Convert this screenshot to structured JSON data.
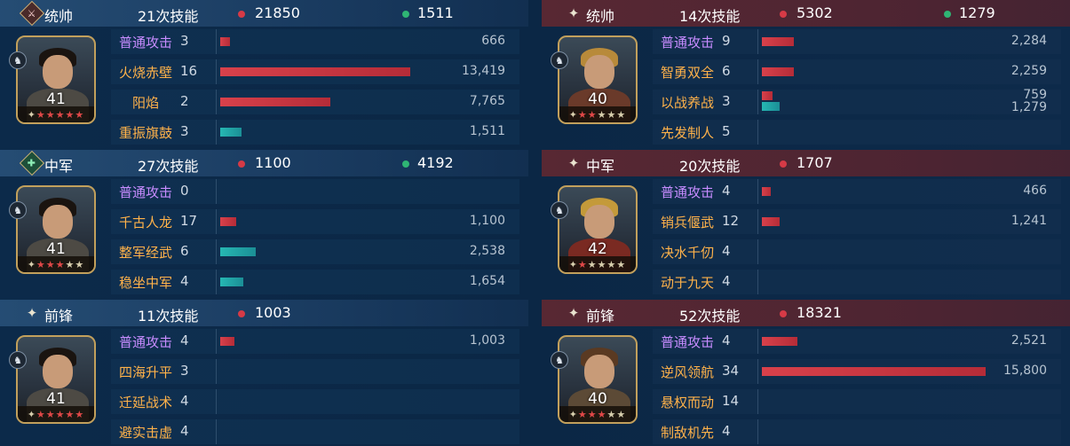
{
  "left": {
    "general": {
      "role": "统帅",
      "casts": "21次技能",
      "dmg": "21850",
      "heal": "1511",
      "level": "41",
      "stars_red": 5,
      "stars_gray": 0
    },
    "mid": {
      "role": "中军",
      "casts": "27次技能",
      "dmg": "1100",
      "heal": "4192",
      "level": "41",
      "stars_red": 3,
      "stars_gray": 2
    },
    "front": {
      "role": "前锋",
      "casts": "11次技能",
      "dmg": "1003",
      "heal": "",
      "level": "41",
      "stars_red": 5,
      "stars_gray": 0
    }
  },
  "right": {
    "general": {
      "role": "统帅",
      "casts": "14次技能",
      "dmg": "5302",
      "heal": "1279",
      "level": "40",
      "stars_red": 2,
      "stars_gray": 3
    },
    "mid": {
      "role": "中军",
      "casts": "20次技能",
      "dmg": "1707",
      "heal": "",
      "level": "42",
      "stars_red": 1,
      "stars_gray": 4
    },
    "front": {
      "role": "前锋",
      "casts": "52次技能",
      "dmg": "18321",
      "heal": "",
      "level": "40",
      "stars_red": 3,
      "stars_gray": 2
    }
  },
  "skills": {
    "l0": [
      {
        "name": "普通攻击",
        "count": "3",
        "basic": true,
        "dmg": 666,
        "dmg_label": "666"
      },
      {
        "name": "火烧赤壁",
        "count": "16",
        "dmg": 13419,
        "dmg_label": "13,419"
      },
      {
        "name": "阳焰",
        "count": "2",
        "center": true,
        "dmg": 7765,
        "dmg_label": "7,765"
      },
      {
        "name": "重振旗鼓",
        "count": "3",
        "heal": 1511,
        "heal_label": "1,511"
      }
    ],
    "l1": [
      {
        "name": "普通攻击",
        "count": "0",
        "basic": true
      },
      {
        "name": "千古人龙",
        "count": "17",
        "dmg": 1100,
        "dmg_label": "1,100"
      },
      {
        "name": "整军经武",
        "count": "6",
        "heal": 2538,
        "heal_label": "2,538"
      },
      {
        "name": "稳坐中军",
        "count": "4",
        "heal": 1654,
        "heal_label": "1,654"
      }
    ],
    "l2": [
      {
        "name": "普通攻击",
        "count": "4",
        "basic": true,
        "dmg": 1003,
        "dmg_label": "1,003"
      },
      {
        "name": "四海升平",
        "count": "3"
      },
      {
        "name": "迁延战术",
        "count": "4"
      },
      {
        "name": "避实击虚",
        "count": "4"
      }
    ],
    "r0": [
      {
        "name": "普通攻击",
        "count": "9",
        "basic": true,
        "dmg": 2284,
        "dmg_label": "2,284"
      },
      {
        "name": "智勇双全",
        "count": "6",
        "dmg": 2259,
        "dmg_label": "2,259"
      },
      {
        "name": "以战养战",
        "count": "3",
        "dmg": 759,
        "dmg_label": "759",
        "heal": 1279,
        "heal_label": "1,279"
      },
      {
        "name": "先发制人",
        "count": "5"
      }
    ],
    "r1": [
      {
        "name": "普通攻击",
        "count": "4",
        "basic": true,
        "dmg": 466,
        "dmg_label": "466"
      },
      {
        "name": "销兵偃武",
        "count": "12",
        "dmg": 1241,
        "dmg_label": "1,241"
      },
      {
        "name": "决水千仞",
        "count": "4"
      },
      {
        "name": "动于九天",
        "count": "4"
      }
    ],
    "r2": [
      {
        "name": "普通攻击",
        "count": "4",
        "basic": true,
        "dmg": 2521,
        "dmg_label": "2,521"
      },
      {
        "name": "逆风领航",
        "count": "34",
        "dmg": 15800,
        "dmg_label": "15,800"
      },
      {
        "name": "悬权而动",
        "count": "14"
      },
      {
        "name": "制敌机先",
        "count": "4"
      }
    ]
  },
  "colors": {
    "damage": "#c8333f",
    "heal": "#22a6a6",
    "basic_attack": "#c78cff",
    "skill": "#ffb24a"
  }
}
